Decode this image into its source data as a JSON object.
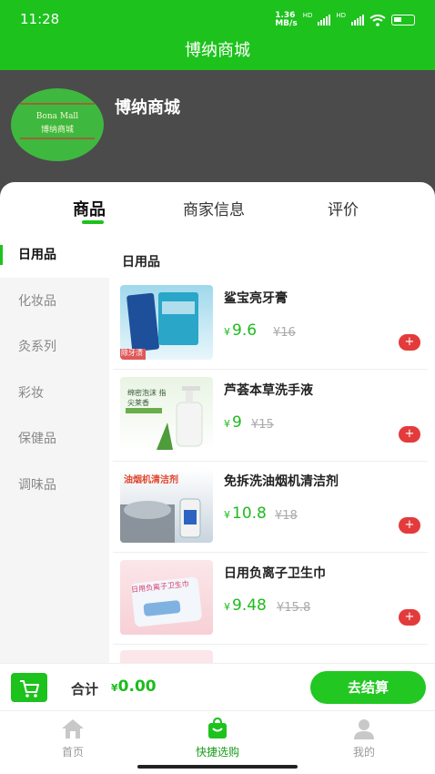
{
  "status_bar": {
    "time": "11:28",
    "net_speed": "1.36",
    "net_unit": "MB/s",
    "hd1": "HD",
    "hd2": "HD"
  },
  "title_bar": {
    "title": "博纳商城"
  },
  "store": {
    "name": "博纳商城",
    "logo_text_en": "Bona Mall",
    "logo_text_cn": "博纳商城"
  },
  "tabs": [
    {
      "label": "商品",
      "active": true
    },
    {
      "label": "商家信息",
      "active": false
    },
    {
      "label": "评价",
      "active": false
    }
  ],
  "sidebar": {
    "items": [
      {
        "label": "日用品",
        "active": true
      },
      {
        "label": "化妆品",
        "active": false
      },
      {
        "label": "灸系列",
        "active": false
      },
      {
        "label": "彩妆",
        "active": false
      },
      {
        "label": "保健品",
        "active": false
      },
      {
        "label": "调味品",
        "active": false
      }
    ]
  },
  "category_title": "日用品",
  "currency_symbol": "¥",
  "products": [
    {
      "name": "鲨宝亮牙膏",
      "price": "9.6",
      "old_price": "¥16",
      "thumb_caption": "除牙渍",
      "add": "+"
    },
    {
      "name": "芦荟本草洗手液",
      "price": "9",
      "old_price": "¥15",
      "thumb_caption": "绵密泡沫 指尖莱香",
      "add": "+"
    },
    {
      "name": "免拆洗油烟机清洁剂",
      "price": "10.8",
      "old_price": "¥18",
      "thumb_caption": "油烟机清洁剂",
      "add": "+"
    },
    {
      "name": "日用负离子卫生巾",
      "price": "9.48",
      "old_price": "¥15.8",
      "thumb_caption": "日用负离子卫生巾",
      "add": "+"
    }
  ],
  "cart": {
    "total_label": "合计",
    "currency": "¥",
    "total_value": "0.00",
    "checkout_label": "去结算"
  },
  "bottom_nav": [
    {
      "label": "首页",
      "icon": "home-icon",
      "active": false
    },
    {
      "label": "快捷选购",
      "icon": "shopping-bag-icon",
      "active": true
    },
    {
      "label": "我的",
      "icon": "user-icon",
      "active": false
    }
  ],
  "colors": {
    "brand_green": "#1dc21d",
    "price_green": "#1dbb1d",
    "add_red": "#e33b3b",
    "header_gray": "#4b4b4b"
  }
}
